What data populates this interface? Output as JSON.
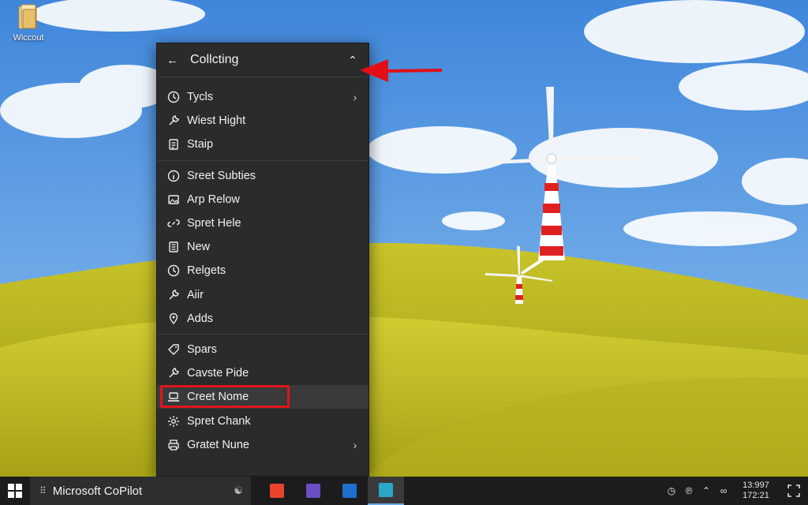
{
  "desktop": {
    "icon_label": "Wiccout"
  },
  "menu": {
    "title": "Collcting",
    "groups": [
      {
        "items": [
          {
            "label": "Tycls",
            "icon": "clock-icon",
            "submenu": true
          },
          {
            "label": "Wiest Hight",
            "icon": "wrench-icon",
            "submenu": false
          },
          {
            "label": "Staip",
            "icon": "document-icon",
            "submenu": false
          }
        ]
      },
      {
        "items": [
          {
            "label": "Sreet Subties",
            "icon": "info-circle-icon",
            "submenu": false
          },
          {
            "label": "Arp Relow",
            "icon": "image-icon",
            "submenu": false
          },
          {
            "label": "Spret Hele",
            "icon": "link-icon",
            "submenu": false
          },
          {
            "label": "New",
            "icon": "notes-icon",
            "submenu": false
          },
          {
            "label": "Relgets",
            "icon": "clock-icon",
            "submenu": false
          },
          {
            "label": "Aiir",
            "icon": "wrench-icon",
            "submenu": false
          },
          {
            "label": "Adds",
            "icon": "location-icon",
            "submenu": false
          }
        ]
      },
      {
        "items": [
          {
            "label": "Spars",
            "icon": "tag-icon",
            "submenu": false
          },
          {
            "label": "Cavste Pide",
            "icon": "wrench-icon",
            "submenu": false
          },
          {
            "label": "Creet Nome",
            "icon": "laptop-icon",
            "submenu": false,
            "highlighted": true
          },
          {
            "label": "Spret Chank",
            "icon": "gear-icon",
            "submenu": false
          },
          {
            "label": "Gratet Nune",
            "icon": "printer-icon",
            "submenu": true
          }
        ]
      }
    ]
  },
  "taskbar": {
    "search_text": "Microsoft CoPilot",
    "search_tag": "⠿",
    "apps": [
      {
        "name": "store-app",
        "color": "#e8442c",
        "active": false
      },
      {
        "name": "teams-app",
        "color": "#6a4fc4",
        "active": false
      },
      {
        "name": "azure-app",
        "color": "#1e6fd0",
        "active": false
      },
      {
        "name": "pinned-app",
        "color": "#2aa6c9",
        "active": true
      }
    ],
    "time": "13:997",
    "date": "172:21"
  },
  "colors": {
    "menu_bg": "#2b2b2b",
    "highlight_frame": "#e0151b",
    "taskbar_bg": "#1c1c1c"
  }
}
